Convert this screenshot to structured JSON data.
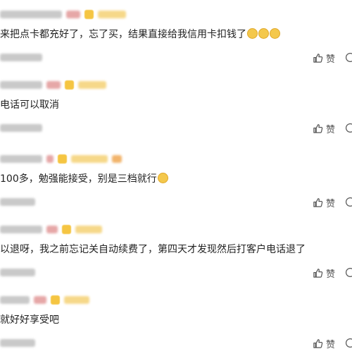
{
  "comments": [
    {
      "text": "来把点卡都充好了，忘了买，结果直接给我信用卡扣钱了",
      "emoji_count": 3,
      "like_label": "赞"
    },
    {
      "text": "电话可以取消",
      "emoji_count": 0,
      "like_label": "赞"
    },
    {
      "text": "100多，勉强能接受，别是三档就行",
      "emoji_count": 1,
      "like_label": "赞"
    },
    {
      "text": "以退呀，我之前忘记关自动续费了，第四天才发现然后打客户电话退了",
      "emoji_count": 0,
      "like_label": "赞"
    },
    {
      "text": "就好好享受吧",
      "emoji_count": 0,
      "like_label": "赞"
    }
  ]
}
